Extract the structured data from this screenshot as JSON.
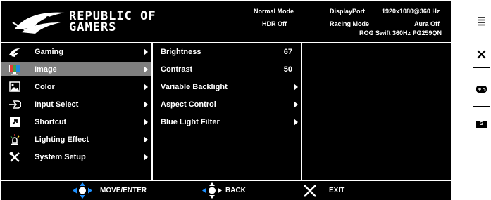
{
  "header": {
    "brand_line1": "REPUBLIC OF",
    "brand_line2": "GAMERS",
    "mode": "Normal Mode",
    "hdr": "HDR Off",
    "input": "DisplayPort",
    "resolution": "1920x1080@360 Hz",
    "racing": "Racing Mode",
    "aura": "Aura Off",
    "model": "ROG Swift 360Hz PG259QN"
  },
  "menu": {
    "items": [
      {
        "label": "Gaming",
        "icon": "rog-logo-icon"
      },
      {
        "label": "Image",
        "icon": "image-icon"
      },
      {
        "label": "Color",
        "icon": "color-picture-icon"
      },
      {
        "label": "Input Select",
        "icon": "input-icon"
      },
      {
        "label": "Shortcut",
        "icon": "shortcut-icon"
      },
      {
        "label": "Lighting Effect",
        "icon": "light-icon"
      },
      {
        "label": "System Setup",
        "icon": "tools-icon"
      }
    ],
    "selected_index": 1
  },
  "submenu": {
    "items": [
      {
        "label": "Brightness",
        "value": "67"
      },
      {
        "label": "Contrast",
        "value": "50"
      },
      {
        "label": "Variable Backlight",
        "value": ""
      },
      {
        "label": "Aspect Control",
        "value": ""
      },
      {
        "label": "Blue Light Filter",
        "value": ""
      }
    ]
  },
  "footer": {
    "move": "MOVE/ENTER",
    "back": "BACK",
    "exit": "EXIT"
  },
  "sidebar": {
    "menu_icon": "menu-icon",
    "close_icon": "close-icon",
    "gamepad_icon": "gamepad-icon",
    "g_badge": "G"
  },
  "colors": {
    "panel_bg": "#000000",
    "selected_bg": "#7f7f7f",
    "nav_blue": "#1e90ff"
  }
}
